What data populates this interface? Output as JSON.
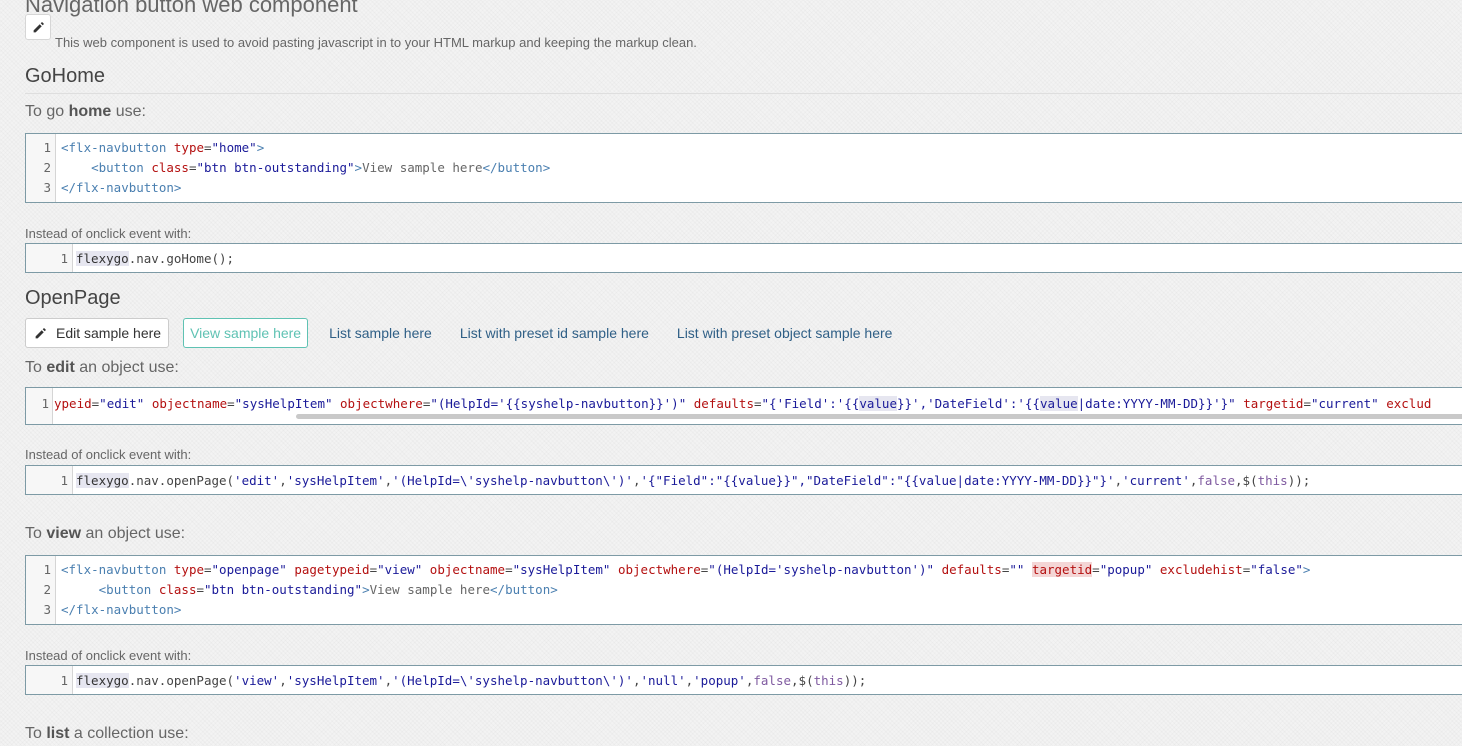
{
  "page": {
    "title": "Navigation button web component",
    "subtitle": "This web component is used to avoid pasting javascript in to your HTML markup and keeping the markup clean."
  },
  "gohome": {
    "heading": "GoHome",
    "intro_pre": "To go ",
    "intro_bold": "home",
    "intro_post": " use:",
    "instead_label": "Instead of onclick event with:"
  },
  "openpage": {
    "heading": "OpenPage",
    "buttons": {
      "edit": "Edit sample here",
      "view": "View sample here",
      "list": "List sample here",
      "list_preset_id": "List with preset id sample here",
      "list_preset_object": "List with preset object sample here"
    },
    "edit_intro_pre": "To ",
    "edit_intro_bold": "edit",
    "edit_intro_post": " an object use:",
    "instead_label_1": "Instead of onclick event with:",
    "view_intro_pre": "To ",
    "view_intro_bold": "view",
    "view_intro_post": " an object use:",
    "instead_label_2": "Instead of onclick event with:",
    "list_intro_pre": "To ",
    "list_intro_bold": "list",
    "list_intro_post": " a collection use:"
  },
  "code": {
    "gohome_markup": {
      "numbers": [
        "1",
        "2",
        "3"
      ],
      "l1": {
        "open": "<flx-navbutton ",
        "a1": "type",
        "eq1": "=",
        "v1": "\"home\"",
        "close": ">"
      },
      "l2": {
        "indent": "    ",
        "open": "<button ",
        "a1": "class",
        "eq1": "=",
        "v1": "\"btn btn-outstanding\"",
        "gt": ">",
        "text": "View sample here",
        "close": "</button>"
      },
      "l3": {
        "close": "</flx-navbutton>"
      }
    },
    "gohome_js": {
      "numbers": [
        "1"
      ],
      "obj": "flexygo",
      "rest": ".nav.goHome();"
    },
    "edit_markup": {
      "numbers": [
        "1"
      ],
      "s1": "ypeid",
      "s2": "=",
      "s3": "\"edit\"",
      "s4": " ",
      "s5": "objectname",
      "s6": "=",
      "s7": "\"sysHelpItem\"",
      "s8": " ",
      "s9": "objectwhere",
      "s10": "=",
      "s11": "\"(HelpId='{{syshelp-navbutton}}')\"",
      "s12": " ",
      "s13": "defaults",
      "s14": "=",
      "s15a": "\"{'Field':'{{",
      "s15b": "value",
      "s15c": "}}','DateField':'{{",
      "s15d": "value",
      "s15e": "|date:YYYY-MM-DD}}'}\"",
      "s16": " ",
      "s17": "targetid",
      "s18": "=",
      "s19": "\"current\"",
      "s20": " ",
      "s21": "exclud"
    },
    "edit_js": {
      "numbers": [
        "1"
      ],
      "obj": "flexygo",
      "p1": ".nav.openPage(",
      "p2": "'edit'",
      "p3": ",",
      "p4": "'sysHelpItem'",
      "p5": ",",
      "p6": "'(HelpId=\\'syshelp-navbutton\\')'",
      "p7": ",",
      "p8": "'{\"Field\":\"{{value}}\",\"DateField\":\"{{value|date:YYYY-MM-DD}}\"}'",
      "p9": ",",
      "p10": "'current'",
      "p11": ",",
      "p12": "false",
      "p13": ",$(",
      "p14": "this",
      "p15": "));"
    },
    "view_markup": {
      "numbers": [
        "1",
        "2",
        "3"
      ],
      "l1": {
        "t1": "<flx-navbutton ",
        "a1": "type",
        "e1": "=",
        "v1": "\"openpage\"",
        "a2": " pagetypeid",
        "e2": "=",
        "v2": "\"view\"",
        "a3": " objectname",
        "e3": "=",
        "v3": "\"sysHelpItem\"",
        "a4": " objectwhere",
        "e4": "=",
        "v4": "\"(HelpId='syshelp-navbutton')\"",
        "a5": " defaults",
        "e5": "=",
        "v5": "\"\"",
        "sp": " ",
        "a6": "targetid",
        "e6": "=",
        "v6": "\"popup\"",
        "a7": " excludehist",
        "e7": "=",
        "v7": "\"false\"",
        "close": ">"
      },
      "l2": {
        "indent": "     ",
        "open": "<button ",
        "a1": "class",
        "eq1": "=",
        "v1": "\"btn btn-outstanding\"",
        "gt": ">",
        "text": "View sample here",
        "close": "</button>"
      },
      "l3": {
        "close": "</flx-navbutton>"
      }
    },
    "view_js": {
      "numbers": [
        "1"
      ],
      "obj": "flexygo",
      "p1": ".nav.openPage(",
      "p2": "'view'",
      "p3": ",",
      "p4": "'sysHelpItem'",
      "p5": ",",
      "p6": "'(HelpId=\\'syshelp-navbutton\\')'",
      "p7": ",",
      "p8": "'null'",
      "p9": ",",
      "p10": "'popup'",
      "p11": ",",
      "p12": "false",
      "p13": ",$(",
      "p14": "this",
      "p15": "));"
    }
  },
  "icons": {
    "top_edit": "pencil-icon",
    "edit_button": "pencil-icon"
  }
}
